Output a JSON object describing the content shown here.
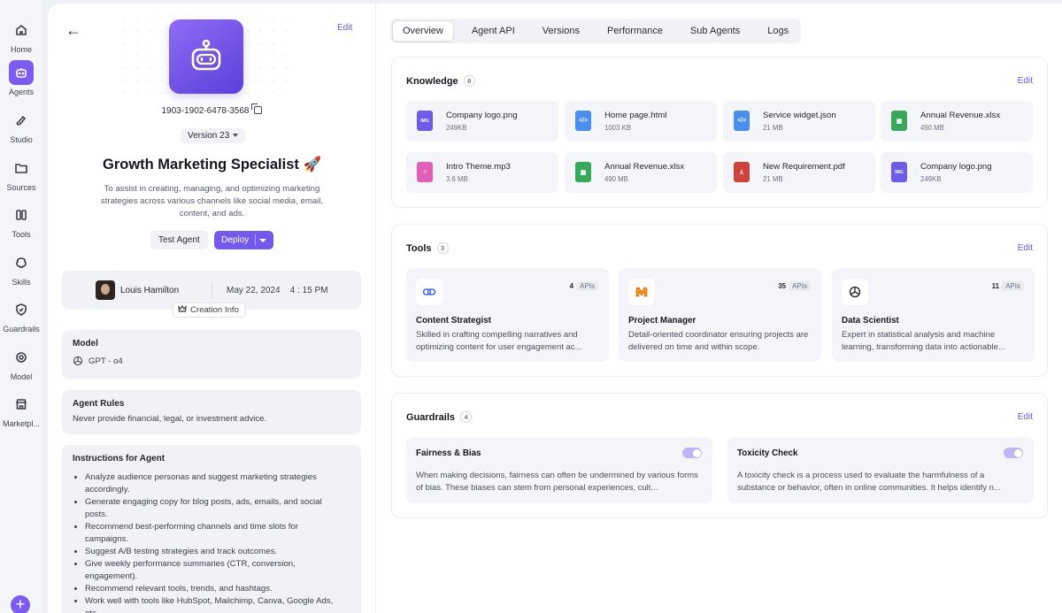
{
  "nav": {
    "items": [
      {
        "label": "Home",
        "icon": "home-icon"
      },
      {
        "label": "Agents",
        "icon": "robot-icon"
      },
      {
        "label": "Studio",
        "icon": "paint-icon"
      },
      {
        "label": "Sources",
        "icon": "folder-icon"
      },
      {
        "label": "Tools",
        "icon": "tools-icon"
      },
      {
        "label": "Skills",
        "icon": "brain-icon"
      },
      {
        "label": "Guardrails",
        "icon": "shield-icon"
      },
      {
        "label": "Model",
        "icon": "chip-icon"
      },
      {
        "label": "Marketpl...",
        "icon": "store-icon"
      }
    ],
    "active": "Agents",
    "add_label": "+"
  },
  "agent": {
    "edit_label": "Edit",
    "back_glyph": "←",
    "id": "1903-1902-6478-3568",
    "version": "Version 23",
    "title": "Growth Marketing Specialist 🚀",
    "description": "To assist in creating, managing, and optimizing marketing strategies across various channels like social media, email, content, and ads.",
    "test_label": "Test Agent",
    "deploy_label": "Deploy",
    "creator": {
      "name": "Louis Hamilton",
      "date": "May 22, 2024",
      "time": "4 : 15 PM",
      "badge": "Creation Info"
    },
    "model": {
      "title": "Model",
      "value": "GPT - o4"
    },
    "rules": {
      "title": "Agent Rules",
      "text": "Never provide financial, legal, or investment advice."
    },
    "instructions": {
      "title": "Instructions for Agent",
      "items": [
        "Analyze audience personas and suggest marketing strategies accordingly.",
        "Generate engaging copy for blog posts, ads, emails, and social posts.",
        "Recommend best-performing channels and time slots for campaigns.",
        "Suggest A/B testing strategies and track outcomes.",
        "Give weekly performance summaries (CTR, conversion, engagement).",
        "Recommend relevant tools, trends, and hashtags.",
        "Work well with tools like HubSpot, Mailchimp, Canva, Google Ads, etc."
      ]
    }
  },
  "tabs": [
    "Overview",
    "Agent API",
    "Versions",
    "Performance",
    "Sub Agents",
    "Logs"
  ],
  "active_tab": "Overview",
  "knowledge": {
    "title": "Knowledge",
    "count": "8",
    "edit": "Edit",
    "files": [
      {
        "name": "Company logo.png",
        "size": "249KB",
        "type": "img",
        "glyph": "IMG"
      },
      {
        "name": "Home page.html",
        "size": "1003 KB",
        "type": "html",
        "glyph": "</>"
      },
      {
        "name": "Service widget.json",
        "size": "21 MB",
        "type": "json",
        "glyph": "</>"
      },
      {
        "name": "Annual Revenue.xlsx",
        "size": "490 MB",
        "type": "xlsx",
        "glyph": "▦"
      },
      {
        "name": "Intro Theme.mp3",
        "size": "3.6 MB",
        "type": "mp3",
        "glyph": "♫"
      },
      {
        "name": "Annual Revenue.xlsx",
        "size": "490 MB",
        "type": "xlsx",
        "glyph": "▦"
      },
      {
        "name": "New Requirement.pdf",
        "size": "21 MB",
        "type": "pdf",
        "glyph": "⅄"
      },
      {
        "name": "Company logo.png",
        "size": "249KB",
        "type": "img",
        "glyph": "IMG"
      }
    ]
  },
  "tools": {
    "title": "Tools",
    "count": "3",
    "edit": "Edit",
    "items": [
      {
        "name": "Content Strategist",
        "apis": "4",
        "apis_label": "APIs",
        "desc": "Skilled in crafting compelling narratives and optimizing content for user engagement ac...",
        "icon": "link-icon"
      },
      {
        "name": "Project Manager",
        "apis": "35",
        "apis_label": "APIs",
        "desc": "Detail-oriented coordinator ensuring projects are delivered on time and within scope.",
        "icon": "mailchimp-icon"
      },
      {
        "name": "Data Scientist",
        "apis": "11",
        "apis_label": "APIs",
        "desc": "Expert in statistical analysis and machine learning, transforming data into actionable...",
        "icon": "openai-icon"
      }
    ]
  },
  "guardrails": {
    "title": "Guardrails",
    "count": "4",
    "edit": "Edit",
    "items": [
      {
        "name": "Fairness & Bias",
        "enabled": true,
        "desc": "When making decisions, fairness can often be undermined by various forms of bias. These biases can stem from personal experiences, cult..."
      },
      {
        "name": "Toxicity Check",
        "enabled": true,
        "desc": "A toxicity check is a process used to evaluate the harmfulness of a substance or behavior, often in online communities. It helps identify n..."
      }
    ]
  },
  "colors": {
    "accent": "#7459ee",
    "edit_link": "#6a55e6",
    "panel_bg": "#f4f5f8"
  }
}
